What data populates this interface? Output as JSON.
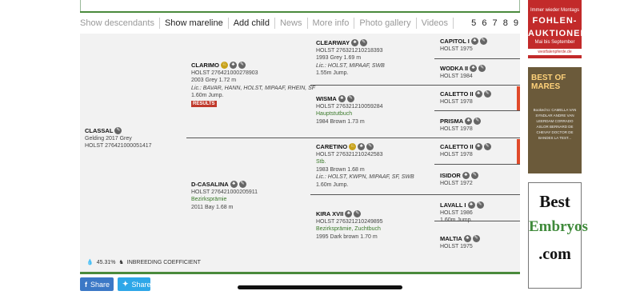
{
  "tabs": [
    {
      "label": "Show descendants",
      "style": "dim"
    },
    {
      "label": "Show mareline",
      "style": "dark"
    },
    {
      "label": "Add child",
      "style": "dark"
    },
    {
      "label": "News",
      "style": "dim"
    },
    {
      "label": "More info",
      "style": "dim"
    },
    {
      "label": "Photo gallery",
      "style": "dim"
    },
    {
      "label": "Videos",
      "style": "dim"
    }
  ],
  "pages": "5 6 7 8 9",
  "subject": {
    "name": "CLASSAL",
    "line1": "Gelding 2017 Grey",
    "line2": "HOLST 276421000051417"
  },
  "sire": {
    "name": "CLARIMO",
    "line1": "HOLST 276421000278903",
    "line2": "2003 Grey 1.72 m",
    "lic": "Lic.: BAVAR, HANN, HOLST, MIPAAF, RHEIN, SF",
    "line3": "1.60m Jump.",
    "badge": "RESULTS"
  },
  "dam": {
    "name": "D-CASALINA",
    "line1": "HOLST 276421000205911",
    "green": "Bezirksprämie",
    "line2": "2011 Bay 1.68 m"
  },
  "ss": {
    "name": "CLEARWAY",
    "line1": "HOLST 276321210218393",
    "line2": "1993 Grey 1.69 m",
    "lic": "Lic.: HOLST, MIPAAF, SWB",
    "line3": "1.55m Jump."
  },
  "sd": {
    "name": "WISMA",
    "line1": "HOLST 276321210059284",
    "green": "Hauptstutbuch",
    "line2": "1984 Brown 1.73 m"
  },
  "ds": {
    "name": "CARETINO",
    "line1": "HOLST 276321210242583",
    "green": "Stb.",
    "line2": "1983 Brown 1.68 m",
    "lic": "Lic.: HOLST, KWPN, MIPAAF, SF, SWB",
    "line3": "1.60m Jump."
  },
  "dd": {
    "name": "KIRA XVII",
    "line1": "HOLST 276321210249895",
    "green": "Bezirksprämie, Zuchtbuch",
    "line2": "1995 Dark brown 1.70 m"
  },
  "gen3": [
    {
      "name": "CAPITOL I",
      "line1": "HOLST 1975"
    },
    {
      "name": "WODKA II",
      "line1": "HOLST 1984"
    },
    {
      "name": "CALETTO II",
      "line1": "HOLST 1978"
    },
    {
      "name": "PRISMA",
      "line1": "HOLST 1978"
    },
    {
      "name": "CALETTO II",
      "line1": "HOLST 1978"
    },
    {
      "name": "ISIDOR",
      "line1": "HOLST 1972"
    },
    {
      "name": "LAVALL I",
      "line1": "HOLST 1986",
      "line2": "1.60m Jump."
    },
    {
      "name": "MALTIA",
      "line1": "HOLST 1975"
    }
  ],
  "inbreeding": {
    "value": "45.31%",
    "label": "INBREEDING COEFFICIENT"
  },
  "share": {
    "facebook": "Share",
    "twitter": "Share"
  },
  "ads": {
    "ad1": {
      "top": "Immer wieder Montags",
      "big1": "FOHLEN-",
      "big2": "AUKTIONEN",
      "mid": "Mai bis September",
      "foot": "westfalenpferde.de"
    },
    "ad2": {
      "title": "BEST OF MARES",
      "small": "Booked to: CAMELLA VAN SYNDLAR ANDRE VAN LEERDAM CORRADO ASLOR BERNARD DE CHEVAY DOCTOR DE BANDES LA TEST..."
    },
    "ad3": {
      "w1": "Best",
      "w2": "Embryos",
      "w3": ".com"
    }
  },
  "colors": {
    "accent_green": "#4a8a3c",
    "badge_red": "#c0392b",
    "fb_blue": "#3b78c6",
    "tw_blue": "#2ea7e8"
  }
}
